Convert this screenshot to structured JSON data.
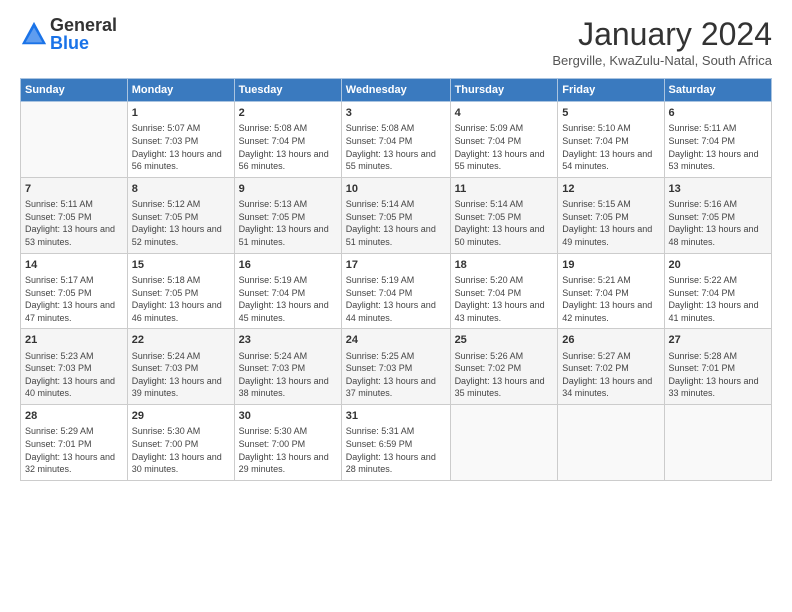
{
  "logo": {
    "general": "General",
    "blue": "Blue"
  },
  "title": "January 2024",
  "subtitle": "Bergville, KwaZulu-Natal, South Africa",
  "days_of_week": [
    "Sunday",
    "Monday",
    "Tuesday",
    "Wednesday",
    "Thursday",
    "Friday",
    "Saturday"
  ],
  "weeks": [
    [
      {
        "day": "",
        "sunrise": "",
        "sunset": "",
        "daylight": ""
      },
      {
        "day": "1",
        "sunrise": "Sunrise: 5:07 AM",
        "sunset": "Sunset: 7:03 PM",
        "daylight": "Daylight: 13 hours and 56 minutes."
      },
      {
        "day": "2",
        "sunrise": "Sunrise: 5:08 AM",
        "sunset": "Sunset: 7:04 PM",
        "daylight": "Daylight: 13 hours and 56 minutes."
      },
      {
        "day": "3",
        "sunrise": "Sunrise: 5:08 AM",
        "sunset": "Sunset: 7:04 PM",
        "daylight": "Daylight: 13 hours and 55 minutes."
      },
      {
        "day": "4",
        "sunrise": "Sunrise: 5:09 AM",
        "sunset": "Sunset: 7:04 PM",
        "daylight": "Daylight: 13 hours and 55 minutes."
      },
      {
        "day": "5",
        "sunrise": "Sunrise: 5:10 AM",
        "sunset": "Sunset: 7:04 PM",
        "daylight": "Daylight: 13 hours and 54 minutes."
      },
      {
        "day": "6",
        "sunrise": "Sunrise: 5:11 AM",
        "sunset": "Sunset: 7:04 PM",
        "daylight": "Daylight: 13 hours and 53 minutes."
      }
    ],
    [
      {
        "day": "7",
        "sunrise": "Sunrise: 5:11 AM",
        "sunset": "Sunset: 7:05 PM",
        "daylight": "Daylight: 13 hours and 53 minutes."
      },
      {
        "day": "8",
        "sunrise": "Sunrise: 5:12 AM",
        "sunset": "Sunset: 7:05 PM",
        "daylight": "Daylight: 13 hours and 52 minutes."
      },
      {
        "day": "9",
        "sunrise": "Sunrise: 5:13 AM",
        "sunset": "Sunset: 7:05 PM",
        "daylight": "Daylight: 13 hours and 51 minutes."
      },
      {
        "day": "10",
        "sunrise": "Sunrise: 5:14 AM",
        "sunset": "Sunset: 7:05 PM",
        "daylight": "Daylight: 13 hours and 51 minutes."
      },
      {
        "day": "11",
        "sunrise": "Sunrise: 5:14 AM",
        "sunset": "Sunset: 7:05 PM",
        "daylight": "Daylight: 13 hours and 50 minutes."
      },
      {
        "day": "12",
        "sunrise": "Sunrise: 5:15 AM",
        "sunset": "Sunset: 7:05 PM",
        "daylight": "Daylight: 13 hours and 49 minutes."
      },
      {
        "day": "13",
        "sunrise": "Sunrise: 5:16 AM",
        "sunset": "Sunset: 7:05 PM",
        "daylight": "Daylight: 13 hours and 48 minutes."
      }
    ],
    [
      {
        "day": "14",
        "sunrise": "Sunrise: 5:17 AM",
        "sunset": "Sunset: 7:05 PM",
        "daylight": "Daylight: 13 hours and 47 minutes."
      },
      {
        "day": "15",
        "sunrise": "Sunrise: 5:18 AM",
        "sunset": "Sunset: 7:05 PM",
        "daylight": "Daylight: 13 hours and 46 minutes."
      },
      {
        "day": "16",
        "sunrise": "Sunrise: 5:19 AM",
        "sunset": "Sunset: 7:04 PM",
        "daylight": "Daylight: 13 hours and 45 minutes."
      },
      {
        "day": "17",
        "sunrise": "Sunrise: 5:19 AM",
        "sunset": "Sunset: 7:04 PM",
        "daylight": "Daylight: 13 hours and 44 minutes."
      },
      {
        "day": "18",
        "sunrise": "Sunrise: 5:20 AM",
        "sunset": "Sunset: 7:04 PM",
        "daylight": "Daylight: 13 hours and 43 minutes."
      },
      {
        "day": "19",
        "sunrise": "Sunrise: 5:21 AM",
        "sunset": "Sunset: 7:04 PM",
        "daylight": "Daylight: 13 hours and 42 minutes."
      },
      {
        "day": "20",
        "sunrise": "Sunrise: 5:22 AM",
        "sunset": "Sunset: 7:04 PM",
        "daylight": "Daylight: 13 hours and 41 minutes."
      }
    ],
    [
      {
        "day": "21",
        "sunrise": "Sunrise: 5:23 AM",
        "sunset": "Sunset: 7:03 PM",
        "daylight": "Daylight: 13 hours and 40 minutes."
      },
      {
        "day": "22",
        "sunrise": "Sunrise: 5:24 AM",
        "sunset": "Sunset: 7:03 PM",
        "daylight": "Daylight: 13 hours and 39 minutes."
      },
      {
        "day": "23",
        "sunrise": "Sunrise: 5:24 AM",
        "sunset": "Sunset: 7:03 PM",
        "daylight": "Daylight: 13 hours and 38 minutes."
      },
      {
        "day": "24",
        "sunrise": "Sunrise: 5:25 AM",
        "sunset": "Sunset: 7:03 PM",
        "daylight": "Daylight: 13 hours and 37 minutes."
      },
      {
        "day": "25",
        "sunrise": "Sunrise: 5:26 AM",
        "sunset": "Sunset: 7:02 PM",
        "daylight": "Daylight: 13 hours and 35 minutes."
      },
      {
        "day": "26",
        "sunrise": "Sunrise: 5:27 AM",
        "sunset": "Sunset: 7:02 PM",
        "daylight": "Daylight: 13 hours and 34 minutes."
      },
      {
        "day": "27",
        "sunrise": "Sunrise: 5:28 AM",
        "sunset": "Sunset: 7:01 PM",
        "daylight": "Daylight: 13 hours and 33 minutes."
      }
    ],
    [
      {
        "day": "28",
        "sunrise": "Sunrise: 5:29 AM",
        "sunset": "Sunset: 7:01 PM",
        "daylight": "Daylight: 13 hours and 32 minutes."
      },
      {
        "day": "29",
        "sunrise": "Sunrise: 5:30 AM",
        "sunset": "Sunset: 7:00 PM",
        "daylight": "Daylight: 13 hours and 30 minutes."
      },
      {
        "day": "30",
        "sunrise": "Sunrise: 5:30 AM",
        "sunset": "Sunset: 7:00 PM",
        "daylight": "Daylight: 13 hours and 29 minutes."
      },
      {
        "day": "31",
        "sunrise": "Sunrise: 5:31 AM",
        "sunset": "Sunset: 6:59 PM",
        "daylight": "Daylight: 13 hours and 28 minutes."
      },
      {
        "day": "",
        "sunrise": "",
        "sunset": "",
        "daylight": ""
      },
      {
        "day": "",
        "sunrise": "",
        "sunset": "",
        "daylight": ""
      },
      {
        "day": "",
        "sunrise": "",
        "sunset": "",
        "daylight": ""
      }
    ]
  ]
}
